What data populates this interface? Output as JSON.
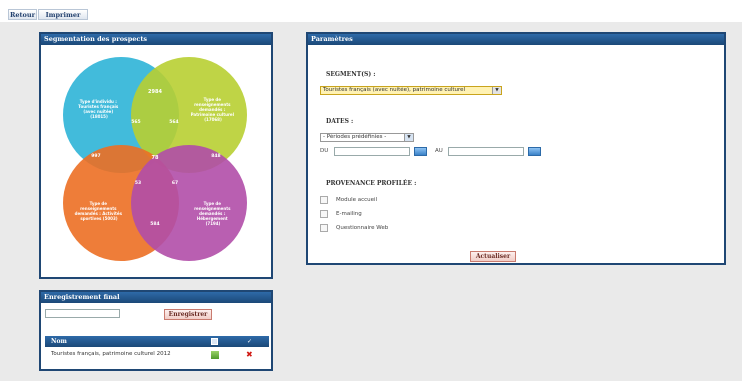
{
  "toolbar": {
    "back_label": "Retour",
    "print_label": "Imprimer"
  },
  "segmentation": {
    "title": "Segmentation des prospects",
    "circles": [
      {
        "label_lines": [
          "Type d'individu :",
          "Touristes français",
          "(avec nuitée)",
          "(18015)"
        ],
        "color": "#2eb4d7"
      },
      {
        "label_lines": [
          "Type de",
          "renseignements",
          "demandés :",
          "Patrimoine culturel",
          "(17068)"
        ],
        "color": "#b8cf32"
      },
      {
        "label_lines": [
          "Type de",
          "renseignements",
          "demandés : Activités",
          "sportives (5003)"
        ],
        "color": "#ec6f24"
      },
      {
        "label_lines": [
          "Type de",
          "renseignements",
          "demandés :",
          "Hébergement",
          "(7194)"
        ],
        "color": "#b14ea8"
      }
    ],
    "numbers": {
      "top_only": "2984",
      "left_top": "565",
      "right_top": "564",
      "left_only": "997",
      "center": "78",
      "right_only": "848",
      "left_bottom": "53",
      "right_bottom": "67",
      "bottom": "584"
    }
  },
  "params": {
    "title": "Paramètres",
    "segment_label": "SEGMENT(S) :",
    "segment_value": "Touristes français (avec nuitée), patrimoine culturel",
    "dates_label": "DATES :",
    "dates_select": "- Périodes prédéfinies -",
    "du_label": "DU",
    "au_label": "AU",
    "provenance_label": "PROVENANCE PROFILÉE :",
    "options": [
      "Module accueil",
      "E-mailing",
      "Questionnaire Web"
    ],
    "update_label": "Actualiser"
  },
  "final": {
    "title": "Enregistrement final",
    "save_label": "Enregistrer",
    "col_name": "Nom",
    "row_name": "Touristes français, patrimoine culturel 2012"
  }
}
